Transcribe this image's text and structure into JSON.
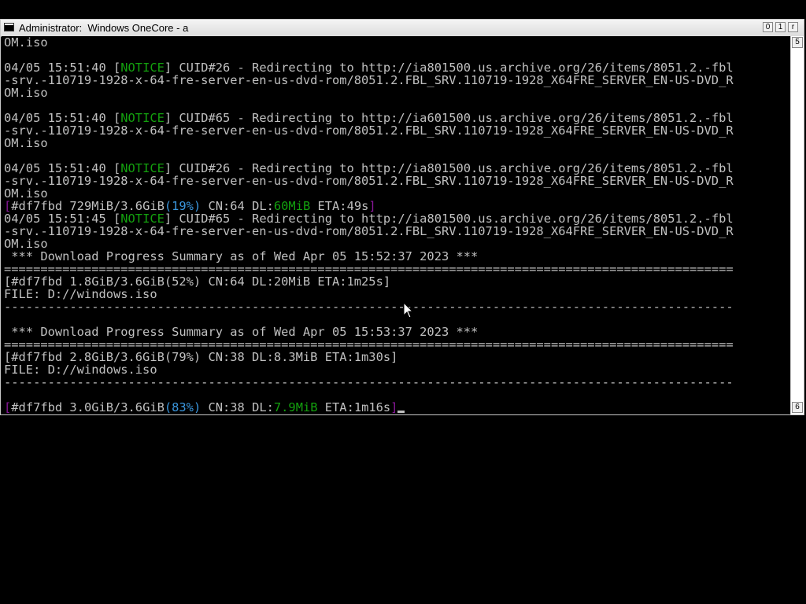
{
  "window": {
    "title": "Administrator:  Windows OneCore - a",
    "buttons": {
      "minimize": "0",
      "maximize": "1",
      "close": "r"
    }
  },
  "scrollbar": {
    "up": "5",
    "down": "6"
  },
  "console": {
    "lines": [
      {
        "segments": [
          {
            "text": "OM.iso"
          }
        ]
      },
      {
        "segments": [
          {
            "text": ""
          }
        ]
      },
      {
        "segments": [
          {
            "text": "04/05 15:51:40 ["
          },
          {
            "text": "NOTICE",
            "color": "green"
          },
          {
            "text": "] CUID#26 - Redirecting to http://ia801500.us.archive.org/26/items/8051.2.-fbl"
          }
        ]
      },
      {
        "segments": [
          {
            "text": "-srv.-110719-1928-x-64-fre-server-en-us-dvd-rom/8051.2.FBL_SRV.110719-1928_X64FRE_SERVER_EN-US-DVD_R"
          }
        ]
      },
      {
        "segments": [
          {
            "text": "OM.iso"
          }
        ]
      },
      {
        "segments": [
          {
            "text": ""
          }
        ]
      },
      {
        "segments": [
          {
            "text": "04/05 15:51:40 ["
          },
          {
            "text": "NOTICE",
            "color": "green"
          },
          {
            "text": "] CUID#65 - Redirecting to http://ia601500.us.archive.org/26/items/8051.2.-fbl"
          }
        ]
      },
      {
        "segments": [
          {
            "text": "-srv.-110719-1928-x-64-fre-server-en-us-dvd-rom/8051.2.FBL_SRV.110719-1928_X64FRE_SERVER_EN-US-DVD_R"
          }
        ]
      },
      {
        "segments": [
          {
            "text": "OM.iso"
          }
        ]
      },
      {
        "segments": [
          {
            "text": ""
          }
        ]
      },
      {
        "segments": [
          {
            "text": "04/05 15:51:40 ["
          },
          {
            "text": "NOTICE",
            "color": "green"
          },
          {
            "text": "] CUID#26 - Redirecting to http://ia801500.us.archive.org/26/items/8051.2.-fbl"
          }
        ]
      },
      {
        "segments": [
          {
            "text": "-srv.-110719-1928-x-64-fre-server-en-us-dvd-rom/8051.2.FBL_SRV.110719-1928_X64FRE_SERVER_EN-US-DVD_R"
          }
        ]
      },
      {
        "segments": [
          {
            "text": "OM.iso"
          }
        ]
      },
      {
        "segments": [
          {
            "text": "[",
            "color": "magenta"
          },
          {
            "text": "#df7fbd 729MiB/3.6GiB"
          },
          {
            "text": "(19%)",
            "color": "cyan"
          },
          {
            "text": " CN:64 DL:"
          },
          {
            "text": "60MiB",
            "color": "green"
          },
          {
            "text": " ETA:49s"
          },
          {
            "text": "]",
            "color": "magenta"
          }
        ]
      },
      {
        "segments": [
          {
            "text": "04/05 15:51:45 ["
          },
          {
            "text": "NOTICE",
            "color": "green"
          },
          {
            "text": "] CUID#65 - Redirecting to http://ia801500.us.archive.org/26/items/8051.2.-fbl"
          }
        ]
      },
      {
        "segments": [
          {
            "text": "-srv.-110719-1928-x-64-fre-server-en-us-dvd-rom/8051.2.FBL_SRV.110719-1928_X64FRE_SERVER_EN-US-DVD_R"
          }
        ]
      },
      {
        "segments": [
          {
            "text": "OM.iso"
          }
        ]
      },
      {
        "segments": [
          {
            "text": " *** Download Progress Summary as of Wed Apr 05 15:52:37 2023 ***"
          }
        ]
      },
      {
        "segments": [
          {
            "text": "===================================================================================================="
          }
        ]
      },
      {
        "segments": [
          {
            "text": "[#df7fbd 1.8GiB/3.6GiB(52%) CN:64 DL:20MiB ETA:1m25s]"
          }
        ]
      },
      {
        "segments": [
          {
            "text": "FILE: D://windows.iso"
          }
        ]
      },
      {
        "segments": [
          {
            "text": "----------------------------------------------------------------------------------------------------"
          }
        ]
      },
      {
        "segments": [
          {
            "text": ""
          }
        ]
      },
      {
        "segments": [
          {
            "text": " *** Download Progress Summary as of Wed Apr 05 15:53:37 2023 ***"
          }
        ]
      },
      {
        "segments": [
          {
            "text": "===================================================================================================="
          }
        ]
      },
      {
        "segments": [
          {
            "text": "[#df7fbd 2.8GiB/3.6GiB(79%) CN:38 DL:8.3MiB ETA:1m30s]"
          }
        ]
      },
      {
        "segments": [
          {
            "text": "FILE: D://windows.iso"
          }
        ]
      },
      {
        "segments": [
          {
            "text": "----------------------------------------------------------------------------------------------------"
          }
        ]
      },
      {
        "segments": [
          {
            "text": ""
          }
        ]
      },
      {
        "segments": [
          {
            "text": "[",
            "color": "magenta"
          },
          {
            "text": "#df7fbd 3.0GiB/3.6GiB"
          },
          {
            "text": "(83%)",
            "color": "cyan"
          },
          {
            "text": " CN:38 DL:"
          },
          {
            "text": "7.9MiB",
            "color": "green"
          },
          {
            "text": " ETA:1m16s"
          },
          {
            "text": "]",
            "color": "magenta"
          }
        ],
        "cursor": true
      }
    ]
  }
}
